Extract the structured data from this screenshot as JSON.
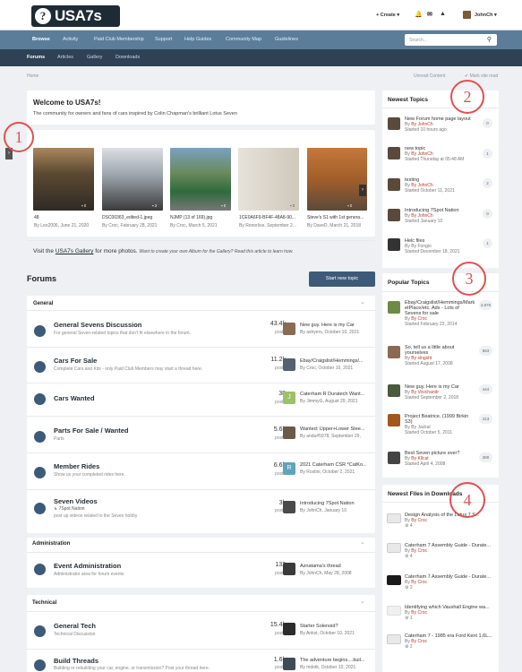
{
  "header": {
    "logo_text": "USA7s",
    "logo_q": "?",
    "create": "Create",
    "user": "JohnCh"
  },
  "nav": {
    "items": [
      "Browse",
      "Activity",
      "Paid Club Membership",
      "Support",
      "Help Guides",
      "Community Map",
      "Guidelines"
    ],
    "search_placeholder": "Search..."
  },
  "subnav": {
    "items": [
      "Forums",
      "Articles",
      "Gallery",
      "Downloads"
    ]
  },
  "breadcrumb": {
    "home": "Home",
    "unread": "Unread Content",
    "mark_read": "Mark site read"
  },
  "welcome": {
    "title": "Welcome to USA7s!",
    "subtitle": "The community for owners and fans of cars inspired by Colin Chapman's brilliant Lotus Seven"
  },
  "gallery": {
    "photos": [
      {
        "title": "48",
        "by": "By Leo2006, June 21, 2020",
        "count": "0"
      },
      {
        "title": "DSC00363_edited-1.jpeg",
        "by": "By Croc, February 28, 2021",
        "count": "2"
      },
      {
        "title": "NJMP (13 of 169).jpg",
        "by": "By Croc, March 5, 2021",
        "count": "0"
      },
      {
        "title": "1CE0A6F9-BF4F-48A8-90...",
        "by": "By Renorlise, September 2...",
        "count": "0"
      },
      {
        "title": "Steve's S1 with 1st genera...",
        "by": "By DaveD, March 21, 2018",
        "count": "0"
      }
    ],
    "note_prefix": "Visit the ",
    "note_link": "USA7s Gallery",
    "note_suffix": " for more photos.",
    "note_italic": "Want to create your own Album for the Gallery? Read this article to learn how."
  },
  "forums": {
    "title": "Forums",
    "start_button": "Start new topic",
    "sections": [
      {
        "name": "General",
        "rows": [
          {
            "name": "General Sevens Discussion",
            "desc": "For general Seven-related topics that don't fit elsewhere in the forum.",
            "count": "43.4k",
            "posts": "posts",
            "last_title": "New guy. Here is my Car",
            "last_by": "By ashyers, October 10, 2021"
          },
          {
            "name": "Cars For Sale",
            "desc": "Complete Cars and Kits - only Paid Club Members may start a thread here.",
            "count": "11.2k",
            "posts": "posts",
            "last_title": "Ebay/Craigslist/Hemmings/...",
            "last_by": "By Croc, October 10, 2021"
          },
          {
            "name": "Cars Wanted",
            "desc": "",
            "count": "38",
            "posts": "posts",
            "last_title": "Caterham R Duratech Want...",
            "last_by": "By JimmyG, August 29, 2021",
            "avatar_letter": "J"
          },
          {
            "name": "Parts For Sale / Wanted",
            "desc": "Parts",
            "count": "5.6k",
            "posts": "posts",
            "last_title": "Wanted: Upper+Lower Stee...",
            "last_by": "By andu#5978, September 29,"
          },
          {
            "name": "Member Rides",
            "desc": "Show us your completed rides here.",
            "count": "6.6k",
            "posts": "posts",
            "last_title": "2021 Caterham CSR *CatKo...",
            "last_by": "By Rostini, October 2, 2021",
            "avatar_letter": "R"
          },
          {
            "name": "Seven Videos",
            "desc": "7Spot Nation",
            "desc2": "post up videos related to the Seven hobby",
            "count": "3k",
            "posts": "posts",
            "last_title": "Introducing 7Spot Nation",
            "last_by": "By JohnCh, January 10"
          }
        ]
      },
      {
        "name": "Administration",
        "rows": [
          {
            "name": "Event Administration",
            "desc": "Administrator area for forum events",
            "count": "132",
            "posts": "posts",
            "last_title": "Aznatama's thread",
            "last_by": "By JohnCh, May 28, 2008"
          }
        ]
      },
      {
        "name": "Technical",
        "rows": [
          {
            "name": "General Tech",
            "desc": "Technical Discussion",
            "count": "15.4k",
            "posts": "posts",
            "last_title": "Starter Solenoid?",
            "last_by": "By Ankst, October 10, 2021"
          },
          {
            "name": "Build Threads",
            "desc": "Building or rebuilding your car, engine, or transmission? Post your thread here.",
            "count": "1.6k",
            "posts": "posts",
            "last_title": "The adventure begins....buil...",
            "last_by": "By mdotk, October 10, 2021"
          }
        ]
      }
    ]
  },
  "newest_topics": {
    "title": "Newest Topics",
    "items": [
      {
        "title": "New Forum home page layout",
        "by": "By JohnCh",
        "when": "Started 10 hours ago",
        "count": "0"
      },
      {
        "title": "new topic",
        "by": "By JohnCh",
        "when": "Started Thursday at 05:48 AM",
        "count": "1"
      },
      {
        "title": "testing",
        "by": "By JohnCh",
        "when": "Started October 11, 2021",
        "count": "2"
      },
      {
        "title": "Introducing 7Spot Nation",
        "by": "By JohnCh",
        "when": "Started January 10",
        "count": "0"
      },
      {
        "title": "Helc files",
        "by": "By Fongio",
        "when": "Started December 18, 2021",
        "count": "1"
      }
    ]
  },
  "popular_topics": {
    "title": "Popular Topics",
    "items": [
      {
        "t1": "Ebay/Craigslist/Hemmings/Mark",
        "t2": "etPlace/etc. Ads - Lots of",
        "t3": "Sevens for sale",
        "by": "By Croc",
        "when": "Started February 23, 2014",
        "count": "2,976"
      },
      {
        "t1": "So, tell us a little about",
        "t2": "yourselves",
        "t3": "",
        "by": "By slngsht",
        "when": "Started August 17, 2008",
        "count": "553"
      },
      {
        "t1": "New guy. Here is my Car",
        "t2": "",
        "t3": "",
        "by": "By Vovchandr",
        "when": "Started September 2, 2018",
        "count": "444"
      },
      {
        "t1": "Project Beatrice. (1999 Birkin",
        "t2": "S3)",
        "t3": "",
        "by": "By Jackal",
        "when": "Started October 5, 2011",
        "count": "413"
      },
      {
        "t1": "Best Seven picture ever?",
        "t2": "",
        "t3": "",
        "by": "By Kllcat",
        "when": "Started April 4, 2008",
        "count": "380"
      }
    ]
  },
  "newest_files": {
    "title": "Newest Files in Downloads",
    "items": [
      {
        "title": "Design Analysis of the Lotus 7 S...",
        "by": "By Croc",
        "count": "4"
      },
      {
        "title": "Caterham 7 Assembly Guide - Durate...",
        "by": "By Croc",
        "count": "4"
      },
      {
        "title": "Caterham 7 Assembly Guide - Durate...",
        "by": "By Croc",
        "count": "2"
      },
      {
        "title": "Identifying which Vauxhall Engine wa...",
        "by": "By Croc",
        "count": "1"
      },
      {
        "title": "Caterham 7 - 1985 era Ford Kent 1.6L...",
        "by": "By Croc",
        "count": "2"
      }
    ]
  },
  "annotations": [
    "1",
    "2",
    "3",
    "4"
  ]
}
